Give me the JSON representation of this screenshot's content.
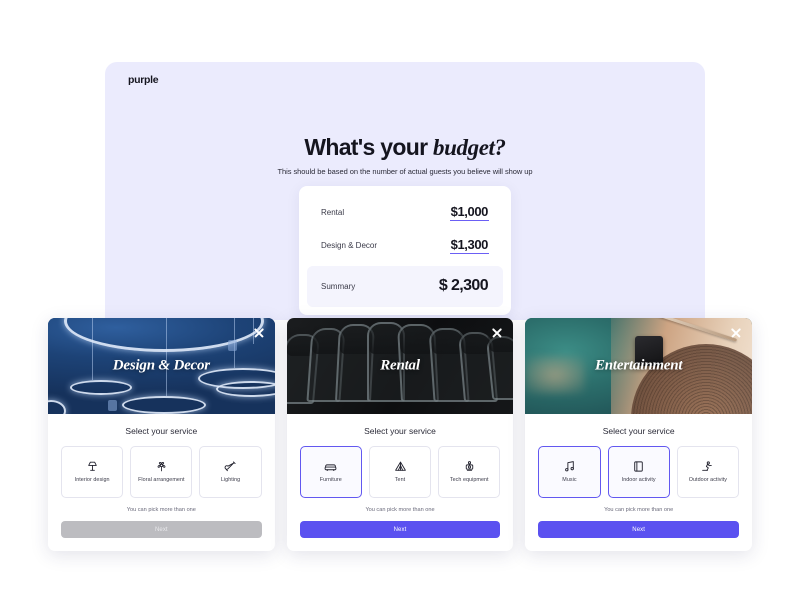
{
  "brand": {
    "logo_text": "purple"
  },
  "hero": {
    "title_plain": "What's your ",
    "title_accent": "budget?",
    "subtitle": "This should be based on the number of actual guests you believe will show up"
  },
  "budget": {
    "rows": [
      {
        "label": "Rental",
        "value": "$1,000"
      },
      {
        "label": "Design & Decor",
        "value": "$1,300"
      }
    ],
    "summary": {
      "label": "Summary",
      "value": "$ 2,300"
    }
  },
  "colors": {
    "accent_purple": "#5b51f0",
    "selected_border": "#6258f0",
    "panel_lavender": "#ebebfd",
    "summary_bg": "#f4f4fd",
    "disabled_button": "#bcbcc0"
  },
  "cards": [
    {
      "title": "Design & Decor",
      "close_icon": "close-icon",
      "body_title": "Select your service",
      "hint": "You can pick more than one",
      "next_label": "Next",
      "next_enabled": false,
      "options": [
        {
          "label": "Interior design",
          "icon": "lamp-icon",
          "selected": false
        },
        {
          "label": "Floral arrangement",
          "icon": "flower-icon",
          "selected": false
        },
        {
          "label": "Lighting",
          "icon": "light-bulb-icon",
          "selected": false
        }
      ]
    },
    {
      "title": "Rental",
      "close_icon": "close-icon",
      "body_title": "Select your service",
      "hint": "You can pick more than one",
      "next_label": "Next",
      "next_enabled": true,
      "options": [
        {
          "label": "Furniture",
          "icon": "sofa-icon",
          "selected": true
        },
        {
          "label": "Tent",
          "icon": "tent-icon",
          "selected": false
        },
        {
          "label": "Tech equipment",
          "icon": "speaker-icon",
          "selected": false
        }
      ]
    },
    {
      "title": "Entertainment",
      "close_icon": "close-icon",
      "body_title": "Select your service",
      "hint": "You can pick more than one",
      "next_label": "Next",
      "next_enabled": true,
      "options": [
        {
          "label": "Music",
          "icon": "music-note-icon",
          "selected": true
        },
        {
          "label": "Indoor activity",
          "icon": "board-game-icon",
          "selected": true
        },
        {
          "label": "Outdoor activity",
          "icon": "person-activity-icon",
          "selected": false
        }
      ]
    }
  ]
}
